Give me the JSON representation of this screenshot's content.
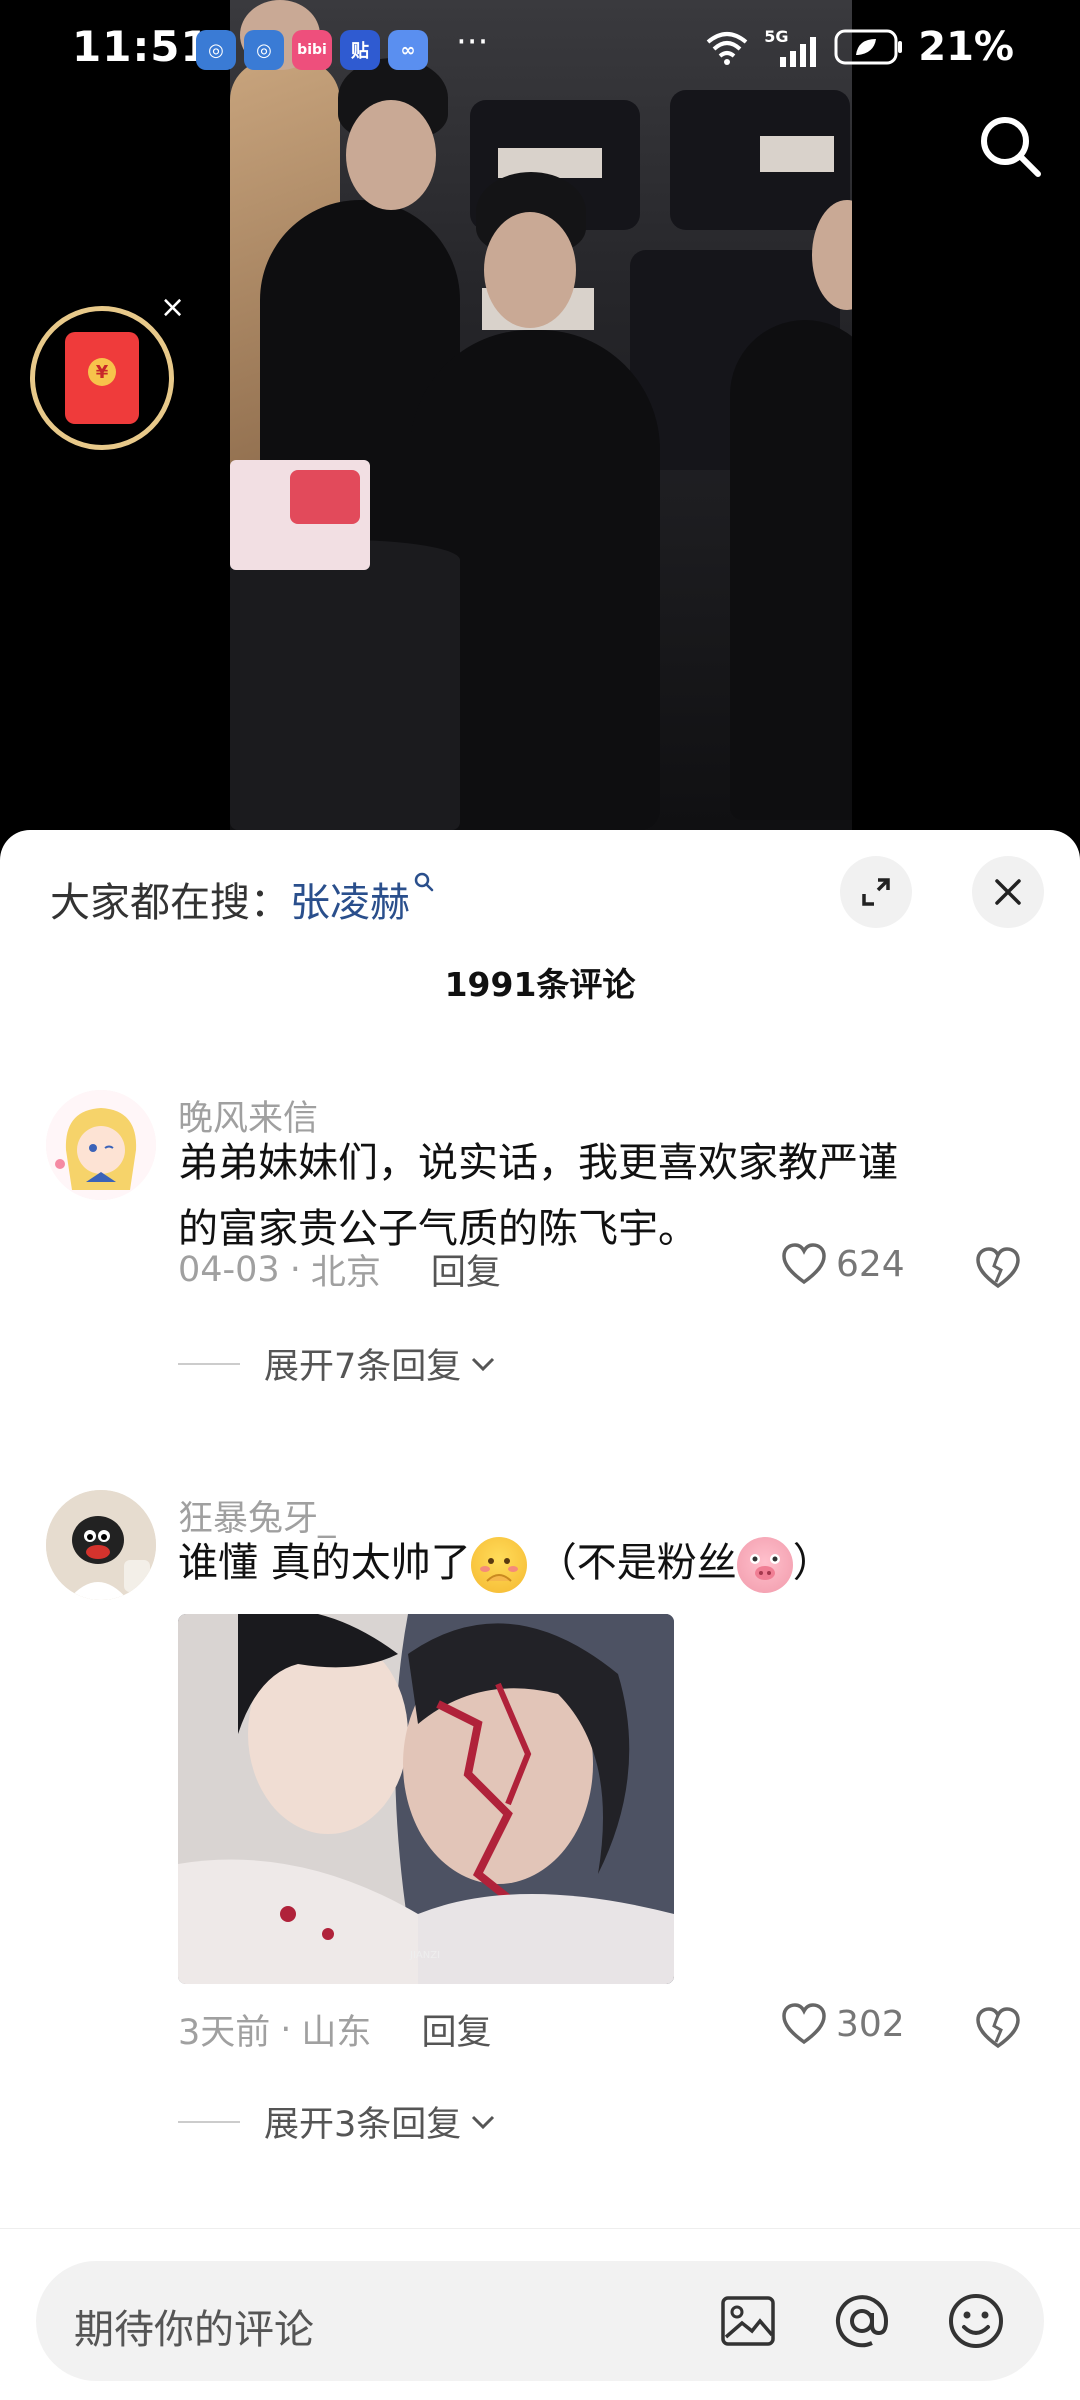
{
  "status_bar": {
    "time": "11:51",
    "apps": [
      "◎",
      "◎",
      "bibi",
      "贴",
      "∞"
    ],
    "more": "···",
    "network": "5G",
    "battery": "21%"
  },
  "video": {
    "search_icon": "search-icon",
    "red_packet_symbol": "¥",
    "close_symbol": "×"
  },
  "sheet": {
    "trending_label": "大家都在搜：",
    "trending_keyword": "张凌赫",
    "comment_count": "1991条评论"
  },
  "comments": [
    {
      "user": "晚风来信",
      "text_line1": "弟弟妹妹们，说实话，我更喜欢家教严谨",
      "text_line2": "的富家贵公子气质的陈飞宇。",
      "date": "04-03",
      "location": "北京",
      "reply_label": "回复",
      "likes": "624",
      "expand_label": "展开7条回复"
    },
    {
      "user": "狂暴兔牙_",
      "text_part1": "谁懂 真的太帅了",
      "text_part2": "（不是粉丝",
      "text_part3": "）",
      "image_watermark": "JIANZI",
      "date": "3天前",
      "location": "山东",
      "reply_label": "回复",
      "likes": "302",
      "expand_label": "展开3条回复"
    }
  ],
  "input": {
    "placeholder": "期待你的评论"
  },
  "colors": {
    "accent_link": "#2a4f8c",
    "red_packet": "#ef3b3b"
  }
}
